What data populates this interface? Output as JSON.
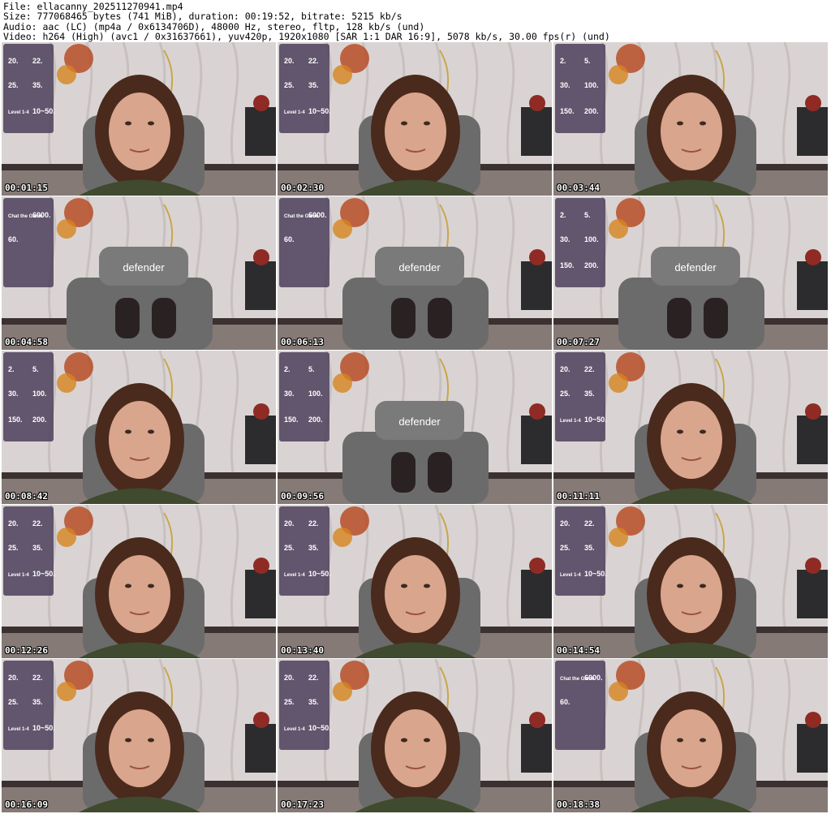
{
  "header": {
    "file": "File: ellacanny_202511270941.mp4",
    "size": "Size: 777068465 bytes (741 MiB), duration: 00:19:52, bitrate: 5215 kb/s",
    "audio": "Audio: aac (LC) (mp4a / 0x6134706D), 48000 Hz, stereo, fltp, 128 kb/s (und)",
    "video": "Video: h264 (High) (avc1 / 0x31637661), yuv420p, 1920x1080 [SAR 1:1 DAR 16:9], 5078 kb/s, 30.00 fps(r) (und)"
  },
  "thumbnails": [
    {
      "timestamp": "00:01:15",
      "scene": "face",
      "overlay": [
        "20.",
        "22.",
        "25.",
        "35.",
        "Level 1-4",
        "10~50."
      ]
    },
    {
      "timestamp": "00:02:30",
      "scene": "face",
      "overlay": [
        "20.",
        "22.",
        "25.",
        "35.",
        "Level 1-4",
        "10~50."
      ]
    },
    {
      "timestamp": "00:03:44",
      "scene": "face",
      "overlay": [
        "2.",
        "5.",
        "30.",
        "100.",
        "150.",
        "200."
      ]
    },
    {
      "timestamp": "00:04:58",
      "scene": "chair",
      "chair_text": "defender",
      "overlay": [
        "Chat the Game",
        "6000.",
        "60."
      ]
    },
    {
      "timestamp": "00:06:13",
      "scene": "chair",
      "chair_text": "defender",
      "overlay": [
        "Chat the Game",
        "6000.",
        "60."
      ]
    },
    {
      "timestamp": "00:07:27",
      "scene": "chair",
      "chair_text": "defender",
      "overlay": [
        "2.",
        "5.",
        "30.",
        "100.",
        "150.",
        "200."
      ]
    },
    {
      "timestamp": "00:08:42",
      "scene": "face",
      "overlay": [
        "2.",
        "5.",
        "30.",
        "100.",
        "150.",
        "200."
      ]
    },
    {
      "timestamp": "00:09:56",
      "scene": "chair",
      "chair_text": "defender",
      "overlay": [
        "2.",
        "5.",
        "30.",
        "100.",
        "150.",
        "200."
      ]
    },
    {
      "timestamp": "00:11:11",
      "scene": "face",
      "overlay": [
        "20.",
        "22.",
        "25.",
        "35.",
        "Level 1-4",
        "10~50."
      ]
    },
    {
      "timestamp": "00:12:26",
      "scene": "face",
      "overlay": [
        "20.",
        "22.",
        "25.",
        "35.",
        "Level 1-4",
        "10~50."
      ]
    },
    {
      "timestamp": "00:13:40",
      "scene": "face",
      "overlay": [
        "20.",
        "22.",
        "25.",
        "35.",
        "Level 1-4",
        "10~50."
      ]
    },
    {
      "timestamp": "00:14:54",
      "scene": "face",
      "overlay": [
        "20.",
        "22.",
        "25.",
        "35.",
        "Level 1-4",
        "10~50."
      ]
    },
    {
      "timestamp": "00:16:09",
      "scene": "face",
      "overlay": [
        "20.",
        "22.",
        "25.",
        "35.",
        "Level 1-4",
        "10~50."
      ]
    },
    {
      "timestamp": "00:17:23",
      "scene": "face",
      "overlay": [
        "20.",
        "22.",
        "25.",
        "35.",
        "Level 1-4",
        "10~50."
      ]
    },
    {
      "timestamp": "00:18:38",
      "scene": "face",
      "overlay": [
        "Chat the Game",
        "6000.",
        "60."
      ]
    }
  ],
  "colors": {
    "wall": "#d9d4d3",
    "panel": "#4b3f5a",
    "chair": "#6b6b6b",
    "hair": "#4a2a1c",
    "skin": "#d9a58c",
    "sweater": "#3f4a2e"
  }
}
